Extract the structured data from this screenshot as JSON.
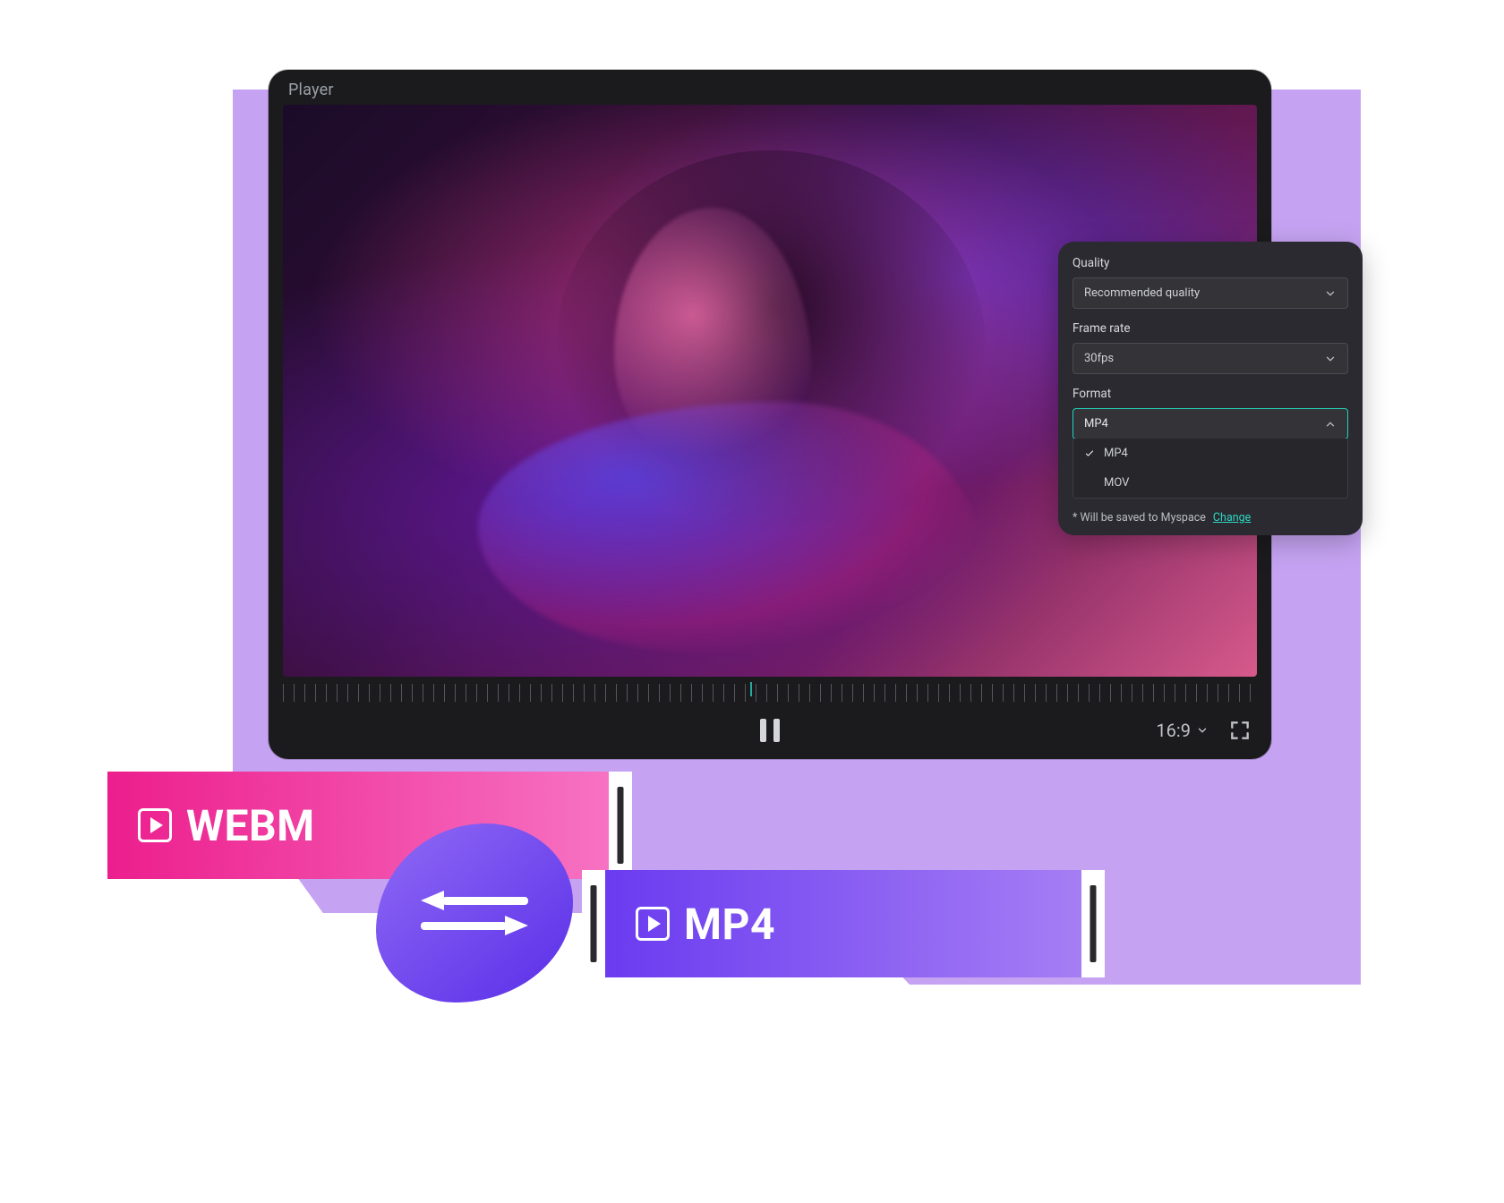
{
  "player": {
    "title": "Player",
    "aspect_ratio": "16:9"
  },
  "panel": {
    "quality": {
      "label": "Quality",
      "value": "Recommended quality"
    },
    "frame_rate": {
      "label": "Frame rate",
      "value": "30fps"
    },
    "format": {
      "label": "Format",
      "value": "MP4",
      "options": [
        "MP4",
        "MOV"
      ],
      "selected_index": 0
    },
    "save_note": "* Will be saved to Myspace",
    "change_link": "Change"
  },
  "chips": {
    "webm": "WEBM",
    "mp4": "MP4"
  },
  "colors": {
    "accent_teal": "#24d3be",
    "pink_a": "#ec1e8d",
    "pink_b": "#f772c2",
    "purple_a": "#6a3bf0",
    "purple_b": "#a57ef4",
    "backing": "#c5a3f2"
  }
}
